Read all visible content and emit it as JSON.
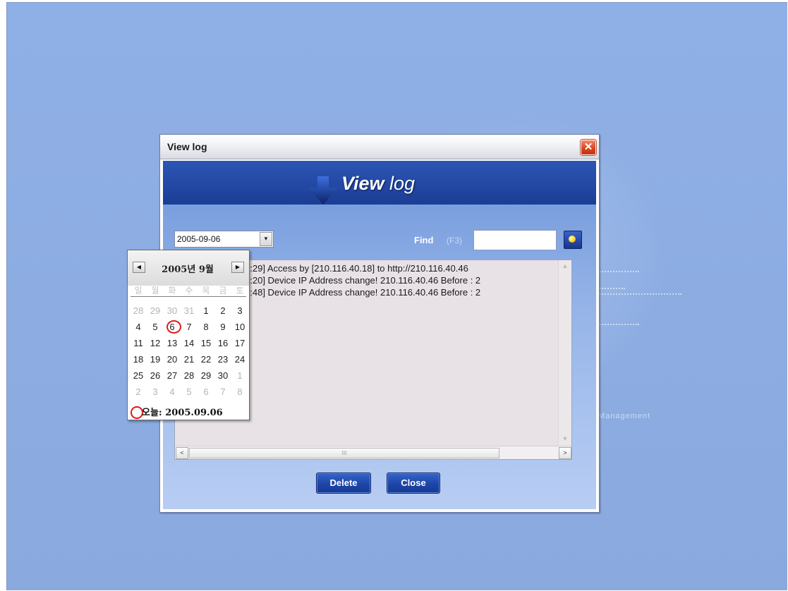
{
  "dialog": {
    "title": "View log",
    "close_glyph": "✕",
    "header_title_bold": "View",
    "header_title_rest": " log",
    "header_icon": "down-arrow-icon"
  },
  "toolbar": {
    "date_value": "2005-09-06",
    "combo_arrow": "▼",
    "find_label": "Find",
    "find_shortcut": "(F3)",
    "find_value": "",
    "find_button_icon": "search-icon"
  },
  "log": {
    "lines": [
      "[2005-09-06 10:30:29] Access by [210.116.40.18] to http://210.116.40.46",
      "[2005-09-06 10:41:20] Device IP Address change! 210.116.40.46 Before : 2",
      "[2005-09-06 10:48:48] Device IP Address change! 210.116.40.46 Before : 2"
    ],
    "scroll_left": "<",
    "scroll_right": ">",
    "thumb_grip": "III"
  },
  "buttons": {
    "delete": "Delete",
    "close": "Close"
  },
  "calendar": {
    "title": "2005년 9월",
    "prev": "◀",
    "next": "▶",
    "weekdays": [
      "일",
      "월",
      "화",
      "수",
      "목",
      "금",
      "토"
    ],
    "weeks": [
      [
        [
          "28",
          true
        ],
        [
          "29",
          true
        ],
        [
          "30",
          true
        ],
        [
          "31",
          true
        ],
        [
          "1",
          false
        ],
        [
          "2",
          false
        ],
        [
          "3",
          false
        ]
      ],
      [
        [
          "4",
          false
        ],
        [
          "5",
          false
        ],
        [
          "6",
          false
        ],
        [
          "7",
          false
        ],
        [
          "8",
          false
        ],
        [
          "9",
          false
        ],
        [
          "10",
          false
        ]
      ],
      [
        [
          "11",
          false
        ],
        [
          "12",
          false
        ],
        [
          "13",
          false
        ],
        [
          "14",
          false
        ],
        [
          "15",
          false
        ],
        [
          "16",
          false
        ],
        [
          "17",
          false
        ]
      ],
      [
        [
          "18",
          false
        ],
        [
          "19",
          false
        ],
        [
          "20",
          false
        ],
        [
          "21",
          false
        ],
        [
          "22",
          false
        ],
        [
          "23",
          false
        ],
        [
          "24",
          false
        ]
      ],
      [
        [
          "25",
          false
        ],
        [
          "26",
          false
        ],
        [
          "27",
          false
        ],
        [
          "28",
          false
        ],
        [
          "29",
          false
        ],
        [
          "30",
          false
        ],
        [
          "1",
          true
        ]
      ],
      [
        [
          "2",
          true
        ],
        [
          "3",
          true
        ],
        [
          "4",
          true
        ],
        [
          "5",
          true
        ],
        [
          "6",
          true
        ],
        [
          "7",
          true
        ],
        [
          "8",
          true
        ]
      ]
    ],
    "selected_day": "6",
    "today_label": "오늘: 2005.09.06"
  },
  "background": {
    "watermark_text": "Management"
  },
  "colors": {
    "header_blue": "#244aa6",
    "button_blue": "#1e45a8",
    "selection_red": "#e01818",
    "desktop_blue": "#8fb0e6"
  }
}
